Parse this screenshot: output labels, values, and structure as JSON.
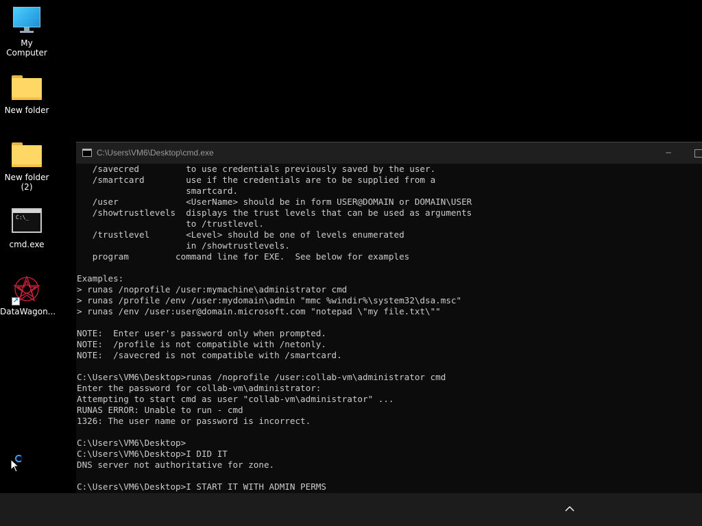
{
  "desktop": {
    "icons": [
      {
        "label": "My Computer",
        "icon": "monitor-icon"
      },
      {
        "label": "New folder",
        "icon": "folder-icon"
      },
      {
        "label": "New folder\n(2)",
        "icon": "folder-icon"
      },
      {
        "label": "cmd.exe",
        "icon": "console-icon"
      },
      {
        "label": "DataWagon...",
        "icon": "datawagon-icon"
      }
    ]
  },
  "window": {
    "title": "C:\\Users\\VM6\\Desktop\\cmd.exe",
    "minimize_glyph": "─",
    "lines": [
      "   /savecred         to use credentials previously saved by the user.",
      "   /smartcard        use if the credentials are to be supplied from a",
      "                     smartcard.",
      "   /user             <UserName> should be in form USER@DOMAIN or DOMAIN\\USER",
      "   /showtrustlevels  displays the trust levels that can be used as arguments",
      "                     to /trustlevel.",
      "   /trustlevel       <Level> should be one of levels enumerated",
      "                     in /showtrustlevels.",
      "   program         command line for EXE.  See below for examples",
      "",
      "Examples:",
      "> runas /noprofile /user:mymachine\\administrator cmd",
      "> runas /profile /env /user:mydomain\\admin \"mmc %windir%\\system32\\dsa.msc\"",
      "> runas /env /user:user@domain.microsoft.com \"notepad \\\"my file.txt\\\"\"",
      "",
      "NOTE:  Enter user's password only when prompted.",
      "NOTE:  /profile is not compatible with /netonly.",
      "NOTE:  /savecred is not compatible with /smartcard.",
      "",
      "C:\\Users\\VM6\\Desktop>runas /noprofile /user:collab-vm\\administrator cmd",
      "Enter the password for collab-vm\\administrator:",
      "Attempting to start cmd as user \"collab-vm\\administrator\" ...",
      "RUNAS ERROR: Unable to run - cmd",
      "1326: The user name or password is incorrect.",
      "",
      "C:\\Users\\VM6\\Desktop>",
      "C:\\Users\\VM6\\Desktop>I DID IT",
      "DNS server not authoritative for zone.",
      "",
      "C:\\Users\\VM6\\Desktop>I START IT WITH ADMIN PERMS"
    ]
  },
  "taskbar": {
    "tray_chevron": "^"
  },
  "colors": {
    "desktop_bg": "#000000",
    "console_bg": "#0c0c0c",
    "console_text": "#cccccc",
    "titlebar_bg": "#1f1f1f",
    "taskbar_bg": "#1c1c1c"
  }
}
